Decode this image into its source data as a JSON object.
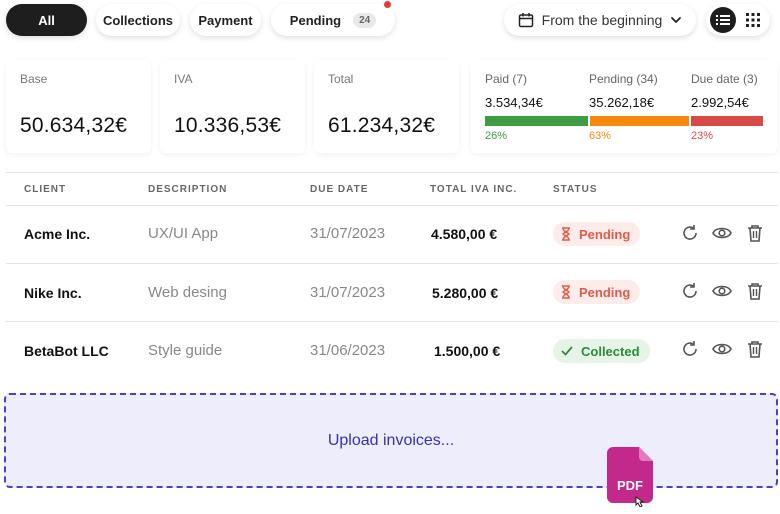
{
  "filters": {
    "tabs": [
      {
        "label": "All",
        "active": true
      },
      {
        "label": "Collections",
        "active": false
      },
      {
        "label": "Payment",
        "active": false
      },
      {
        "label": "Pending",
        "active": false,
        "count": "24",
        "has_notification": true
      }
    ],
    "date_range": {
      "label": "From the beginning",
      "icon": "calendar-icon"
    },
    "view_modes": [
      {
        "name": "list-view-icon",
        "active": true
      },
      {
        "name": "grid-view-icon",
        "active": false
      }
    ]
  },
  "summary": {
    "base": {
      "label": "Base",
      "value": "50.634,32€"
    },
    "iva": {
      "label": "IVA",
      "value": "10.336,53€"
    },
    "total": {
      "label": "Total",
      "value": "61.234,32€"
    },
    "breakdown": [
      {
        "label": "Paid (7)",
        "value": "3.534,34€",
        "percent": "26%",
        "fraction": 0.26,
        "color": "#3d9c44"
      },
      {
        "label": "Pending (34)",
        "value": "35.262,18€",
        "percent": "63%",
        "fraction": 0.63,
        "color": "#f4890d"
      },
      {
        "label": "Due date (3)",
        "value": "2.992,54€",
        "percent": "23%",
        "fraction": 0.23,
        "color": "#d84a48"
      }
    ]
  },
  "table": {
    "headers": [
      "CLIENT",
      "DESCRIPTION",
      "DUE DATE",
      "TOTAL IVA INC.",
      "STATUS"
    ],
    "rows": [
      {
        "client": "Acme Inc.",
        "description": "UX/UI App",
        "due_date": "31/07/2023",
        "total": "4.580,00 €",
        "status": "Pending"
      },
      {
        "client": "Nike Inc.",
        "description": "Web desing",
        "due_date": "31/07/2023",
        "total": "5.280,00 €",
        "status": "Pending"
      },
      {
        "client": "BetaBot LLC",
        "description": "Style guide",
        "due_date": "31/06/2023",
        "total": "1.500,00 €",
        "status": "Collected"
      }
    ],
    "row_actions": [
      "refresh-icon",
      "eye-icon",
      "trash-icon"
    ]
  },
  "upload": {
    "label": "Upload invoices...",
    "file_badge": "PDF",
    "colors": {
      "border": "#4b3fcf",
      "background": "#eeedfb",
      "file": "#c2298a"
    }
  }
}
